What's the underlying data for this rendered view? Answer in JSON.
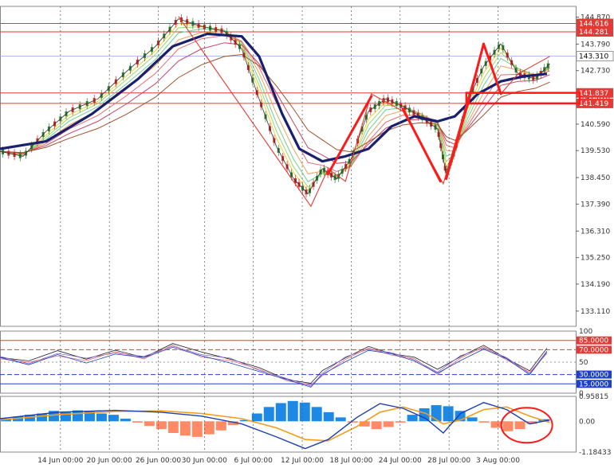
{
  "chart_data": {
    "type": "line",
    "title": "",
    "colors": {
      "candle_up": "#2e7d32",
      "candle_down": "#c62828",
      "ma_slow": "#1a1f6e",
      "level_line": "#e53935",
      "current_line": "#8fa8e8",
      "rsi_upper": "#e53935",
      "rsi_lower": "#1e40c8",
      "macd_positive": "#1e88e5",
      "macd_negative": "#ff8a65",
      "macd_signal": "#f59c1a",
      "macd_line": "#1e3fb0"
    },
    "price_axis": {
      "labels": [
        "144.870",
        "143.790",
        "142.730",
        "141.670",
        "140.590",
        "139.530",
        "138.450",
        "137.390",
        "136.310",
        "135.250",
        "134.190",
        "133.110"
      ],
      "ylim": [
        132.5,
        145.3
      ]
    },
    "price_markers": [
      {
        "label": "144.616",
        "value": 144.616
      },
      {
        "label": "144.281",
        "value": 144.281
      },
      {
        "label": "143.310",
        "value": 143.31
      },
      {
        "label": "141.837",
        "value": 141.837
      },
      {
        "label": "141.419",
        "value": 141.419
      }
    ],
    "current_price": 143.31,
    "x_labels": [
      "14 Jun 00:00",
      "20 Jun 00:00",
      "26 Jun 00:00",
      "30 Jun 00:00",
      "6 Jul 00:00",
      "12 Jul 00:00",
      "18 Jul 00:00",
      "24 Jul 00:00",
      "28 Jul 00:00",
      "3 Aug 00:00"
    ],
    "price_series": [
      [
        0,
        139.5
      ],
      [
        0.04,
        139.3
      ],
      [
        0.08,
        140.3
      ],
      [
        0.12,
        141.1
      ],
      [
        0.17,
        141.6
      ],
      [
        0.22,
        142.7
      ],
      [
        0.27,
        143.7
      ],
      [
        0.31,
        144.8
      ],
      [
        0.35,
        144.5
      ],
      [
        0.39,
        144.3
      ],
      [
        0.42,
        143.6
      ],
      [
        0.45,
        141.6
      ],
      [
        0.48,
        139.7
      ],
      [
        0.51,
        138.4
      ],
      [
        0.535,
        137.8
      ],
      [
        0.56,
        138.8
      ],
      [
        0.585,
        138.4
      ],
      [
        0.61,
        139.2
      ],
      [
        0.64,
        141.1
      ],
      [
        0.67,
        141.6
      ],
      [
        0.7,
        141.3
      ],
      [
        0.73,
        140.9
      ],
      [
        0.76,
        140.4
      ],
      [
        0.775,
        138.6
      ],
      [
        0.79,
        139.5
      ],
      [
        0.81,
        141.4
      ],
      [
        0.84,
        142.9
      ],
      [
        0.87,
        143.8
      ],
      [
        0.9,
        142.6
      ],
      [
        0.93,
        142.4
      ],
      [
        0.955,
        143.0
      ]
    ],
    "ma_slow_series": [
      [
        0,
        139.6
      ],
      [
        0.08,
        139.9
      ],
      [
        0.16,
        141.0
      ],
      [
        0.24,
        142.4
      ],
      [
        0.3,
        143.7
      ],
      [
        0.36,
        144.2
      ],
      [
        0.42,
        144.1
      ],
      [
        0.45,
        143.3
      ],
      [
        0.49,
        141.0
      ],
      [
        0.52,
        139.6
      ],
      [
        0.56,
        139.1
      ],
      [
        0.6,
        139.3
      ],
      [
        0.64,
        139.6
      ],
      [
        0.68,
        140.5
      ],
      [
        0.72,
        140.9
      ],
      [
        0.76,
        140.7
      ],
      [
        0.79,
        140.9
      ],
      [
        0.83,
        141.8
      ],
      [
        0.87,
        142.3
      ],
      [
        0.91,
        142.5
      ],
      [
        0.95,
        142.6
      ]
    ],
    "zigzag": [
      [
        0.31,
        144.9
      ],
      [
        0.54,
        137.3
      ],
      [
        0.57,
        138.8
      ],
      [
        0.6,
        138.3
      ],
      [
        0.645,
        141.8
      ],
      [
        0.7,
        141.1
      ],
      [
        0.77,
        138.2
      ],
      [
        0.84,
        143.8
      ],
      [
        0.87,
        141.8
      ],
      [
        0.9,
        142.6
      ],
      [
        0.955,
        143.3
      ]
    ],
    "rsi": {
      "axis_labels": [
        "100",
        "85.0000",
        "70.0000",
        "50",
        "30.0000",
        "15.0000",
        "0"
      ],
      "levels": [
        85,
        70,
        30,
        15
      ],
      "series": [
        [
          0,
          60
        ],
        [
          0.05,
          52
        ],
        [
          0.1,
          66
        ],
        [
          0.15,
          56
        ],
        [
          0.2,
          68
        ],
        [
          0.25,
          60
        ],
        [
          0.3,
          80
        ],
        [
          0.35,
          64
        ],
        [
          0.4,
          56
        ],
        [
          0.45,
          40
        ],
        [
          0.5,
          24
        ],
        [
          0.54,
          16
        ],
        [
          0.56,
          34
        ],
        [
          0.6,
          58
        ],
        [
          0.64,
          74
        ],
        [
          0.68,
          66
        ],
        [
          0.72,
          58
        ],
        [
          0.76,
          36
        ],
        [
          0.8,
          60
        ],
        [
          0.84,
          76
        ],
        [
          0.88,
          58
        ],
        [
          0.92,
          36
        ],
        [
          0.95,
          70
        ]
      ]
    },
    "macd": {
      "axis_labels": [
        "0.95815",
        "0.00",
        "-1.18433"
      ],
      "ylim": [
        -1.18433,
        0.95815
      ],
      "histogram": [
        0.1,
        0.18,
        0.25,
        0.3,
        0.4,
        0.35,
        0.42,
        0.38,
        0.3,
        0.25,
        0.1,
        -0.05,
        -0.18,
        -0.3,
        -0.45,
        -0.55,
        -0.6,
        -0.5,
        -0.35,
        -0.15,
        0.05,
        0.3,
        0.55,
        0.7,
        0.78,
        0.72,
        0.55,
        0.35,
        0.15,
        -0.05,
        -0.2,
        -0.3,
        -0.22,
        -0.05,
        0.25,
        0.5,
        0.62,
        0.58,
        0.4,
        0.15,
        -0.05,
        -0.25,
        -0.38,
        -0.3,
        -0.1,
        0.08
      ],
      "macd_line": [
        [
          0,
          0.1
        ],
        [
          0.1,
          0.35
        ],
        [
          0.2,
          0.42
        ],
        [
          0.28,
          0.35
        ],
        [
          0.35,
          0.2
        ],
        [
          0.42,
          -0.1
        ],
        [
          0.48,
          -0.6
        ],
        [
          0.53,
          -1.05
        ],
        [
          0.57,
          -0.7
        ],
        [
          0.62,
          0.15
        ],
        [
          0.66,
          0.68
        ],
        [
          0.7,
          0.5
        ],
        [
          0.74,
          0.1
        ],
        [
          0.77,
          -0.45
        ],
        [
          0.8,
          0.3
        ],
        [
          0.84,
          0.72
        ],
        [
          0.88,
          0.45
        ],
        [
          0.92,
          -0.1
        ],
        [
          0.955,
          0.05
        ]
      ],
      "signal_line": [
        [
          0,
          0.05
        ],
        [
          0.1,
          0.25
        ],
        [
          0.2,
          0.38
        ],
        [
          0.28,
          0.4
        ],
        [
          0.35,
          0.3
        ],
        [
          0.42,
          0.1
        ],
        [
          0.48,
          -0.25
        ],
        [
          0.53,
          -0.7
        ],
        [
          0.57,
          -0.75
        ],
        [
          0.62,
          -0.2
        ],
        [
          0.66,
          0.35
        ],
        [
          0.7,
          0.55
        ],
        [
          0.74,
          0.3
        ],
        [
          0.77,
          -0.1
        ],
        [
          0.8,
          0.05
        ],
        [
          0.84,
          0.45
        ],
        [
          0.88,
          0.55
        ],
        [
          0.92,
          0.2
        ],
        [
          0.955,
          -0.05
        ]
      ]
    }
  }
}
